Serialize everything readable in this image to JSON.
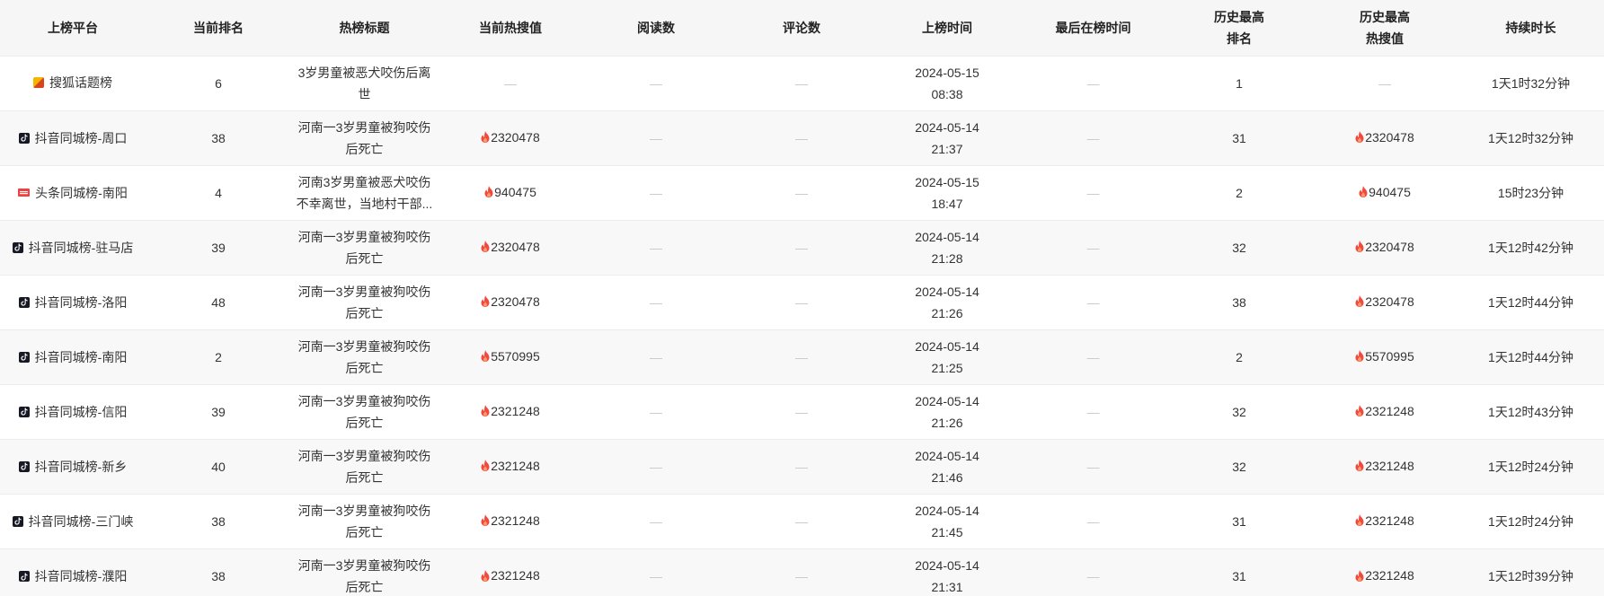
{
  "headers": [
    "上榜平台",
    "当前排名",
    "热榜标题",
    "当前热搜值",
    "阅读数",
    "评论数",
    "上榜时间",
    "最后在榜时间",
    "历史最高\n排名",
    "历史最高\n热搜值",
    "持续时长"
  ],
  "header_lines": {
    "h8a": "历史最高",
    "h8b": "排名",
    "h9a": "历史最高",
    "h9b": "热搜值"
  },
  "colors": {
    "fire": "#f04a3e",
    "douyin": "#161823",
    "toutiao": "#f04142",
    "dash": "#c9c9c9"
  },
  "rows": [
    {
      "platform": "搜狐话题榜",
      "icon": "sohu-icon",
      "rank": "6",
      "title": "3岁男童被恶犬咬伤后离世",
      "heat": "—",
      "reads": "—",
      "comments": "—",
      "date": "2024-05-15",
      "time": "08:38",
      "last": "—",
      "best_rank": "1",
      "best_heat": "—",
      "duration": "1天1时32分钟"
    },
    {
      "platform": "抖音同城榜-周口",
      "icon": "douyin-icon",
      "rank": "38",
      "title": "河南一3岁男童被狗咬伤后死亡",
      "heat": "2320478",
      "reads": "—",
      "comments": "—",
      "date": "2024-05-14",
      "time": "21:37",
      "last": "—",
      "best_rank": "31",
      "best_heat": "2320478",
      "duration": "1天12时32分钟"
    },
    {
      "platform": "头条同城榜-南阳",
      "icon": "toutiao-icon",
      "rank": "4",
      "title": "河南3岁男童被恶犬咬伤不幸离世，当地村干部...",
      "heat": "940475",
      "reads": "—",
      "comments": "—",
      "date": "2024-05-15",
      "time": "18:47",
      "last": "—",
      "best_rank": "2",
      "best_heat": "940475",
      "duration": "15时23分钟"
    },
    {
      "platform": "抖音同城榜-驻马店",
      "icon": "douyin-icon",
      "rank": "39",
      "title": "河南一3岁男童被狗咬伤后死亡",
      "heat": "2320478",
      "reads": "—",
      "comments": "—",
      "date": "2024-05-14",
      "time": "21:28",
      "last": "—",
      "best_rank": "32",
      "best_heat": "2320478",
      "duration": "1天12时42分钟"
    },
    {
      "platform": "抖音同城榜-洛阳",
      "icon": "douyin-icon",
      "rank": "48",
      "title": "河南一3岁男童被狗咬伤后死亡",
      "heat": "2320478",
      "reads": "—",
      "comments": "—",
      "date": "2024-05-14",
      "time": "21:26",
      "last": "—",
      "best_rank": "38",
      "best_heat": "2320478",
      "duration": "1天12时44分钟"
    },
    {
      "platform": "抖音同城榜-南阳",
      "icon": "douyin-icon",
      "rank": "2",
      "title": "河南一3岁男童被狗咬伤后死亡",
      "heat": "5570995",
      "reads": "—",
      "comments": "—",
      "date": "2024-05-14",
      "time": "21:25",
      "last": "—",
      "best_rank": "2",
      "best_heat": "5570995",
      "duration": "1天12时44分钟"
    },
    {
      "platform": "抖音同城榜-信阳",
      "icon": "douyin-icon",
      "rank": "39",
      "title": "河南一3岁男童被狗咬伤后死亡",
      "heat": "2321248",
      "reads": "—",
      "comments": "—",
      "date": "2024-05-14",
      "time": "21:26",
      "last": "—",
      "best_rank": "32",
      "best_heat": "2321248",
      "duration": "1天12时43分钟"
    },
    {
      "platform": "抖音同城榜-新乡",
      "icon": "douyin-icon",
      "rank": "40",
      "title": "河南一3岁男童被狗咬伤后死亡",
      "heat": "2321248",
      "reads": "—",
      "comments": "—",
      "date": "2024-05-14",
      "time": "21:46",
      "last": "—",
      "best_rank": "32",
      "best_heat": "2321248",
      "duration": "1天12时24分钟"
    },
    {
      "platform": "抖音同城榜-三门峡",
      "icon": "douyin-icon",
      "rank": "38",
      "title": "河南一3岁男童被狗咬伤后死亡",
      "heat": "2321248",
      "reads": "—",
      "comments": "—",
      "date": "2024-05-14",
      "time": "21:45",
      "last": "—",
      "best_rank": "31",
      "best_heat": "2321248",
      "duration": "1天12时24分钟"
    },
    {
      "platform": "抖音同城榜-濮阳",
      "icon": "douyin-icon",
      "rank": "38",
      "title": "河南一3岁男童被狗咬伤后死亡",
      "heat": "2321248",
      "reads": "—",
      "comments": "—",
      "date": "2024-05-14",
      "time": "21:31",
      "last": "—",
      "best_rank": "31",
      "best_heat": "2321248",
      "duration": "1天12时39分钟"
    }
  ]
}
